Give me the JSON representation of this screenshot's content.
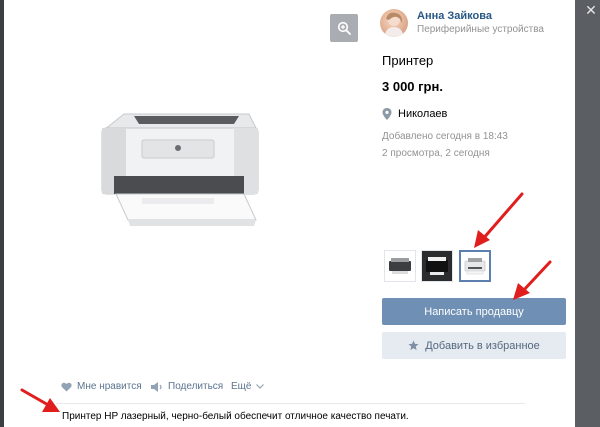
{
  "seller": {
    "name": "Анна Зайкова",
    "category": "Периферийные устройства"
  },
  "item": {
    "title": "Принтер",
    "price": "3 000 грн.",
    "location": "Николаев",
    "added": "Добавлено сегодня в 18:43",
    "views": "2 просмотра, 2 сегодня",
    "description": "Принтер HP лазерный, черно-белый обеспечит отличное качество печати."
  },
  "buttons": {
    "write_seller": "Написать продавцу",
    "add_favorite": "Добавить в избранное"
  },
  "actions": {
    "like": "Мне нравится",
    "share": "Поделиться",
    "more": "Ещё"
  },
  "thumbnails": [
    {
      "name": "thumbnail-1",
      "selected": false
    },
    {
      "name": "thumbnail-2",
      "selected": false
    },
    {
      "name": "thumbnail-3",
      "selected": true
    }
  ],
  "icons": {
    "zoom": "zoom-in-icon",
    "close": "close-icon",
    "location": "location-pin-icon",
    "star": "star-icon",
    "heart": "heart-icon",
    "share": "share-icon",
    "chevron": "chevron-down-icon"
  },
  "colors": {
    "accent": "#6f8fb4",
    "link": "#2a5885",
    "muted": "#939393",
    "annotation_arrow": "#e01e1e"
  }
}
